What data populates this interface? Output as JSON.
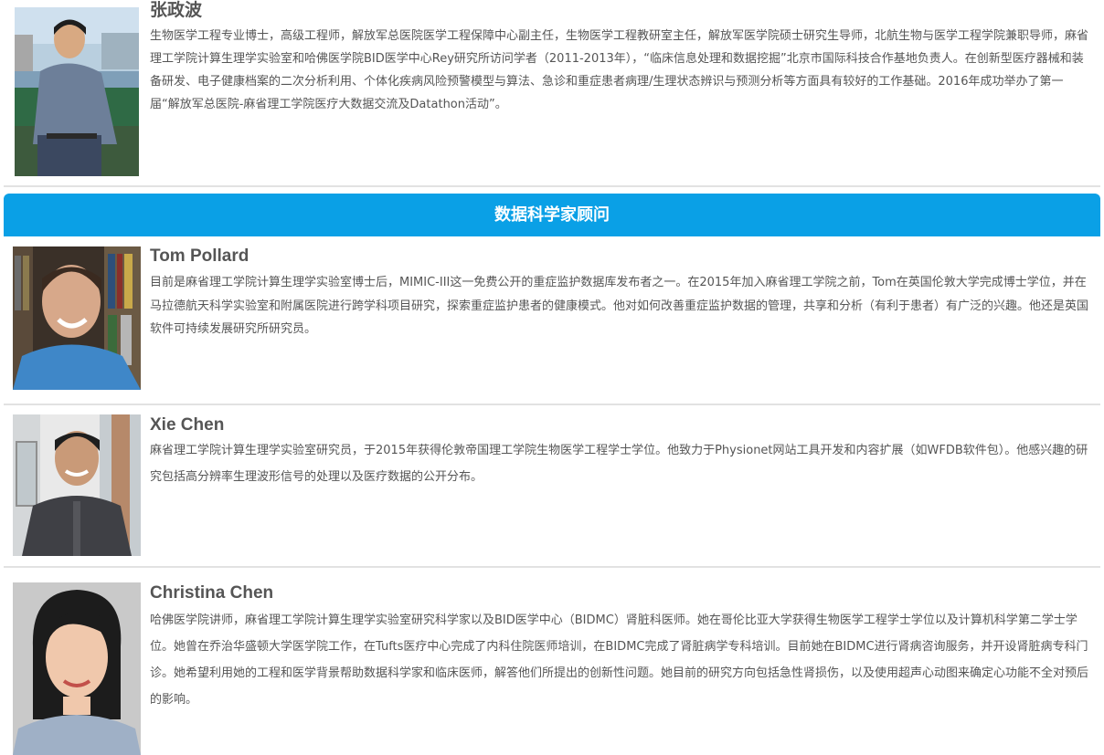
{
  "profiles_top": [
    {
      "name": "张政波",
      "bio": "生物医学工程专业博士，高级工程师，解放军总医院医学工程保障中心副主任，生物医学工程教研室主任，解放军医学院硕士研究生导师，北航生物与医学工程学院兼职导师，麻省理工学院计算生理学实验室和哈佛医学院BID医学中心Rey研究所访问学者（2011-2013年），“临床信息处理和数据挖掘”北京市国际科技合作基地负责人。在创新型医疗器械和装备研发、电子健康档案的二次分析利用、个体化疾病风险预警模型与算法、急诊和重症患者病理/生理状态辨识与预测分析等方面具有较好的工作基础。2016年成功举办了第一届“解放军总医院-麻省理工学院医疗大数据交流及Datathon活动”。"
    }
  ],
  "section": {
    "title": "数据科学家顾问"
  },
  "profiles": [
    {
      "name": "Tom Pollard",
      "bio": "目前是麻省理工学院计算生理学实验室博士后，MIMIC-III这一免费公开的重症监护数据库发布者之一。在2015年加入麻省理工学院之前，Tom在英国伦敦大学完成博士学位，并在马拉德航天科学实验室和附属医院进行跨学科项目研究，探索重症监护患者的健康模式。他对如何改善重症监护数据的管理，共享和分析（有利于患者）有广泛的兴趣。他还是英国软件可持续发展研究所研究员。"
    },
    {
      "name": "Xie Chen",
      "bio": "麻省理工学院计算生理学实验室研究员，于2015年获得伦敦帝国理工学院生物医学工程学士学位。他致力于Physionet网站工具开发和内容扩展（如WFDB软件包）。他感兴趣的研究包括高分辨率生理波形信号的处理以及医疗数据的公开分布。"
    },
    {
      "name": "Christina Chen",
      "bio": "哈佛医学院讲师，麻省理工学院计算生理学实验室研究科学家以及BID医学中心（BIDMC）肾脏科医师。她在哥伦比亚大学获得生物医学工程学士学位以及计算机科学第二学士学位。她曾在乔治华盛顿大学医学院工作，在Tufts医疗中心完成了内科住院医师培训，在BIDMC完成了肾脏病学专科培训。目前她在BIDMC进行肾病咨询服务，并开设肾脏病专科门诊。她希望利用她的工程和医学背景帮助数据科学家和临床医师，解答他们所提出的创新性问题。她目前的研究方向包括急性肾损伤，以及使用超声心动图来确定心功能不全对预后的影响。"
    }
  ]
}
